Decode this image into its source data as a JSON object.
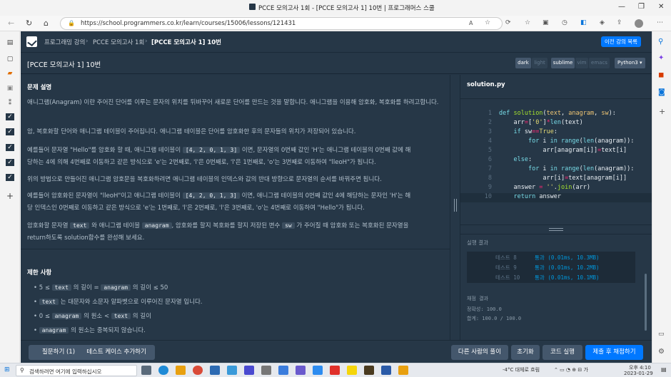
{
  "browser": {
    "tab_title": "PCCE 모의고사 1회 - [PCCE 모의고사 1] 10번 | 프로그래머스 스쿨",
    "url": "https://school.programmers.co.kr/learn/courses/15006/lessons/121431"
  },
  "breadcrumb": {
    "items": [
      "프로그래밍 강의",
      "PCCE 모의고사 1회",
      "[PCCE 모의고사 1] 10번"
    ],
    "prev_button": "이전 강의 목록"
  },
  "header": {
    "title": "[PCCE 모의고사 1] 10번",
    "themes": [
      "dark",
      "light"
    ],
    "keymaps": [
      "sublime",
      "vim",
      "emacs"
    ],
    "language": "Python3"
  },
  "description": {
    "heading": "문제 설명",
    "p1": "애니그램(Anagram) 이란 주어진 단어를 이루는 문자의 위치를 뒤바꾸어 새로운 단어를 만드는 것을 말합니다. 애니그램을 이용해 암호화, 복호화를 하려고합니다.",
    "p2": "암, 복호화할 단어와 애니그램 테이블이 주어집니다. 애니그램 테이블은 단어를 암호화한 후의 문자들의 위치가 저장되어 있습니다.",
    "p3a": "예를들어 문자열 \"Hello\"를 암호화  할 때, 애니그램 테이블이",
    "p3code": "[4, 2, 0, 1, 3]",
    "p3b": "이면, 문자열의 0번째 값인 'H'는 애니그램 테이블의 0번째 값에 해",
    "p3c": "당하는 4에 의해 4번째로 이동하고 같은 방식으로 'e'는 2번째로, 'l'은 0번째로, 'l'은 1번째로, 'o'는 3번째로 이동하여 \"lleoH\"가 됩니다.",
    "p4": "위의 방법으로 만들어진 애니그램 암호문을 복호화하려면 애니그램 테이블의 인덱스와 값의 반대 방향으로 문자열의 순서를 바꿔주면 됩니다.",
    "p5a": "예를들어 암호화된 문자열이 \"lleoH\"이고 애니그램 테이블이",
    "p5code": "[4, 2, 0, 1, 3]",
    "p5b": "이면, 애니그램 테이블의 0번째 값인 4에 해당하는 문자인 'H'는 해",
    "p5c": "당 인덱스인 0번째로 이동하고 같은 방식으로 'e'는 1번째로, 'l'은 2번째로, 'l'은 3번째로, 'o'는 4번째로 이동하여 \"Hello\"가 됩니다.",
    "p6a": "암호화할 문자열",
    "p6code1": "text",
    "p6b": "와 애니그램 테이블",
    "p6code2": "anagram",
    "p6c": ", 암호화를 할지 복호화를 할지 저장된 변수",
    "p6code3": "sw",
    "p6d": "가 주어질 때 암호화 또는 복호화된 문자열을",
    "p6e": "return하도록 solution함수를 완성해 보세요.",
    "limits_heading": "제한 사항",
    "limits": [
      {
        "a": "5 ≤",
        "c1": "text",
        "b": "의 길이 =",
        "c2": "anagram",
        "d": "의 길이 ≤ 50"
      },
      {
        "c1": "text",
        "b": "는 대문자와 소문자 알파벳으로 이루어진 문자열 입니다."
      },
      {
        "a": "0 ≤",
        "c1": "anagram",
        "b": "의 원소 <",
        "c2": "text",
        "d": "의 길이"
      },
      {
        "c1": "anagram",
        "b": "의 원소는 중복되지 않습니다."
      }
    ]
  },
  "editor": {
    "filename": "solution.py",
    "line_numbers": [
      "1",
      "2",
      "3",
      "4",
      "5",
      "6",
      "7",
      "8",
      "9",
      "10"
    ]
  },
  "result": {
    "title": "실행 결과",
    "rows": [
      {
        "name": "테스트 8",
        "res": "통과 (0.01ms, 10.3MB)"
      },
      {
        "name": "테스트 9",
        "res": "통과 (0.01ms, 10.2MB)"
      },
      {
        "name": "테스트 10",
        "res": "통과 (0.01ms, 10.1MB)"
      }
    ],
    "score_title": "채점 결과",
    "accuracy": "정확성: 100.0",
    "total": "합계: 100.0 / 100.0"
  },
  "footer": {
    "ask": "질문하기 (1)",
    "add_tc": "테스트 케이스 추가하기",
    "others": "다른 사람의 풀이",
    "reset": "초기화",
    "run": "코드 실행",
    "submit": "제출 후 채점하기"
  },
  "taskbar": {
    "search_placeholder": "검색하려면 여기에 입력하십시오",
    "weather": "-4°C 대체로 흐림",
    "time": "오후 4:10",
    "date": "2023-01-29"
  }
}
